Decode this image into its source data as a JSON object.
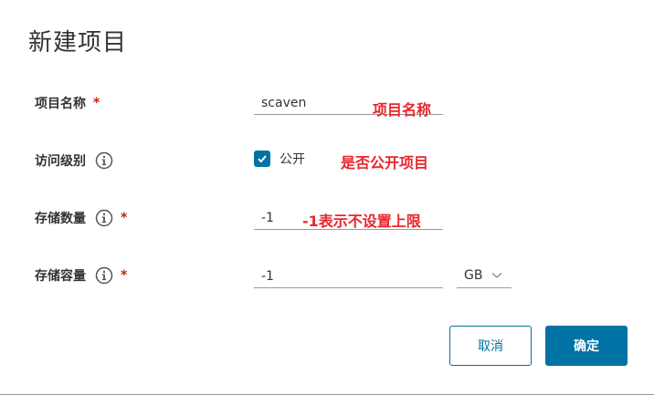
{
  "dialog": {
    "title": "新建项目"
  },
  "form": {
    "project_name": {
      "label": "项目名称",
      "required_mark": "*",
      "value": "scaven",
      "annotation": "项目名称"
    },
    "access_level": {
      "label": "访问级别",
      "checkbox_label": "公开",
      "checked": true,
      "annotation": "是否公开项目"
    },
    "storage_count": {
      "label": "存储数量",
      "required_mark": "*",
      "value": "-1",
      "annotation": "-1表示不设置上限"
    },
    "storage_capacity": {
      "label": "存储容量",
      "required_mark": "*",
      "value": "-1",
      "unit": "GB"
    }
  },
  "buttons": {
    "cancel_label": "取消",
    "ok_label": "确定"
  },
  "colors": {
    "primary": "#0072a3",
    "required": "#c92100",
    "annotation": "#e8262b"
  }
}
